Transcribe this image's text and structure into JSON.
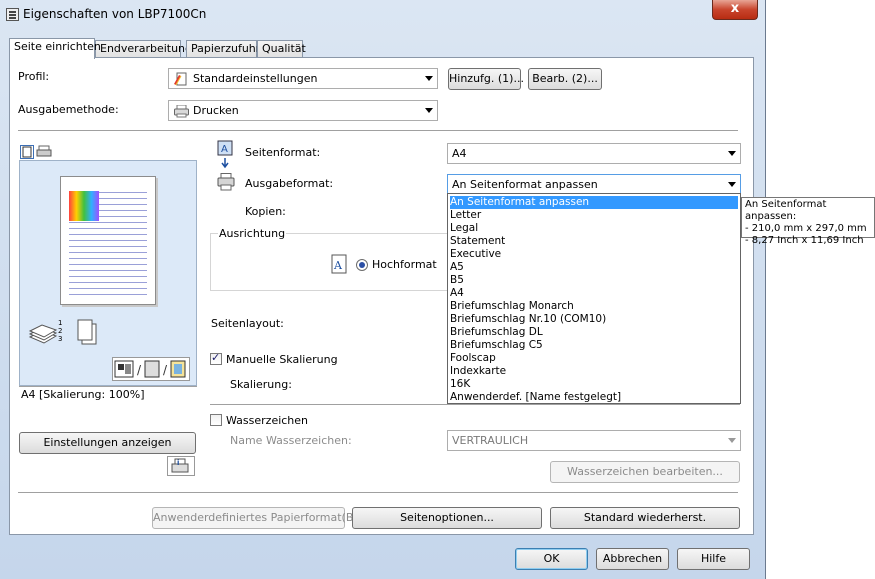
{
  "window": {
    "title": "Eigenschaften von LBP7100Cn",
    "close_label": "x"
  },
  "tabs": [
    {
      "label": "Seite einrichten"
    },
    {
      "label": "Endverarbeitung"
    },
    {
      "label": "Papierzufuhr"
    },
    {
      "label": "Qualität"
    }
  ],
  "profile": {
    "label": "Profil:",
    "value": "Standardeinstellungen",
    "add_button": "Hinzufg. (1)...",
    "edit_button": "Bearb. (2)..."
  },
  "output_method": {
    "label": "Ausgabemethode:",
    "value": "Drucken"
  },
  "preview": {
    "status": "A4 [Skalierung: 100%]",
    "show_settings_button": "Einstellungen anzeigen"
  },
  "page_format": {
    "label": "Seitenformat:",
    "value": "A4"
  },
  "output_format": {
    "label": "Ausgabeformat:",
    "value": "An Seitenformat anpassen",
    "options": [
      "An Seitenformat anpassen",
      "Letter",
      "Legal",
      "Statement",
      "Executive",
      "A5",
      "B5",
      "A4",
      "Briefumschlag Monarch",
      "Briefumschlag Nr.10 (COM10)",
      "Briefumschlag DL",
      "Briefumschlag C5",
      "Foolscap",
      "Indexkarte",
      "16K",
      "Anwenderdef. [Name festgelegt]"
    ],
    "selected_index": 0
  },
  "tooltip": {
    "line1": "An Seitenformat anpassen:",
    "line2": "- 210,0 mm x 297,0 mm",
    "line3": "- 8,27 Inch x 11,69 Inch"
  },
  "copies": {
    "label": "Kopien:"
  },
  "orientation": {
    "group_label": "Ausrichtung",
    "portrait_label": "Hochformat"
  },
  "page_layout": {
    "label": "Seitenlayout:"
  },
  "scaling": {
    "manual_label": "Manuelle Skalierung",
    "manual_checked": true,
    "scale_label": "Skalierung:"
  },
  "watermark": {
    "checkbox_label": "Wasserzeichen",
    "checked": false,
    "name_label": "Name Wasserzeichen:",
    "name_value": "VERTRAULICH",
    "edit_button": "Wasserzeichen bearbeiten..."
  },
  "bottom_buttons": {
    "custom_paper": "Anwenderdefiniertes Papierformat(B)...",
    "page_options": "Seitenoptionen...",
    "restore_defaults": "Standard wiederherst."
  },
  "dialog_buttons": {
    "ok": "OK",
    "cancel": "Abbrechen",
    "help": "Hilfe"
  },
  "colors": {
    "selection": "#3399ff",
    "preview_bg": "#dce9f8",
    "window_frame": "#c5d6eb"
  }
}
